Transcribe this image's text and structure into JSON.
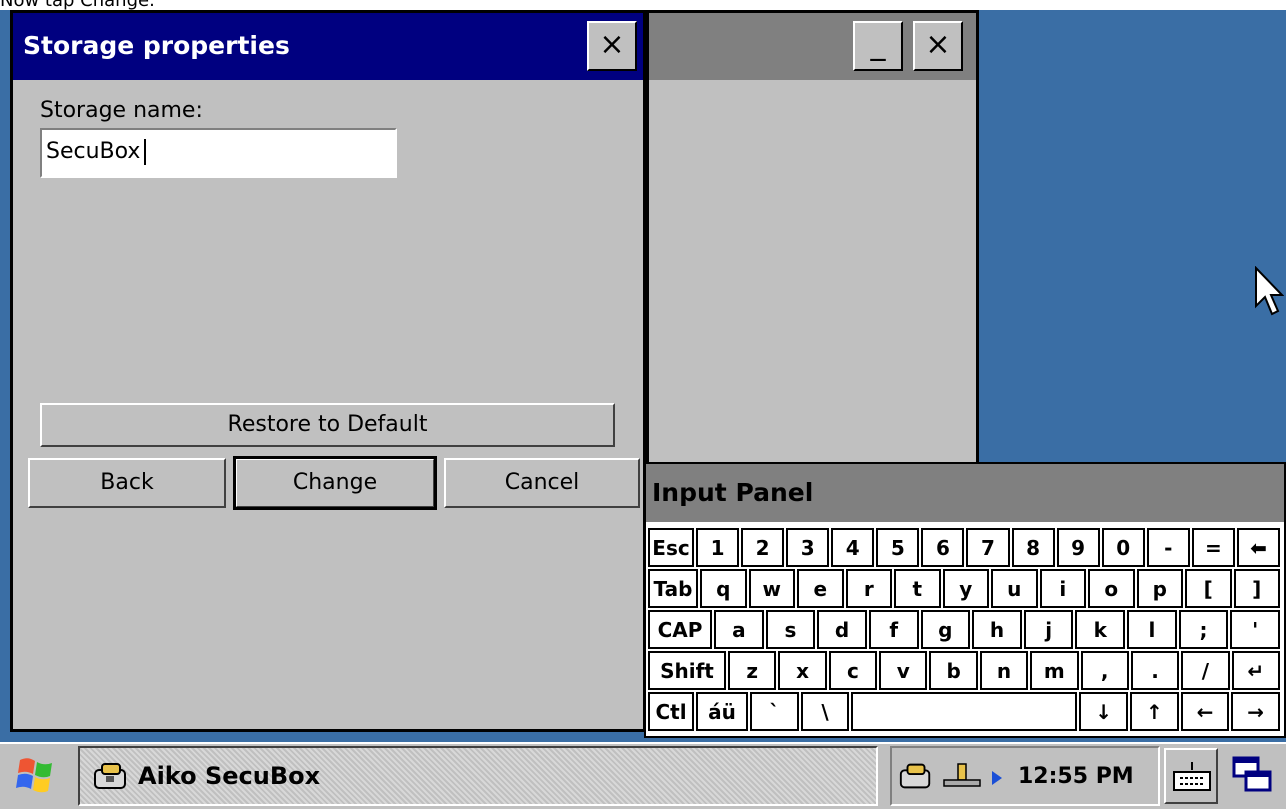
{
  "instruction": "Now tap Change.",
  "dialog": {
    "title": "Storage properties",
    "close_label": "×",
    "storage_name_label": "Storage name:",
    "storage_name_value": "SecuBox",
    "restore_label": "Restore to Default",
    "back_label": "Back",
    "change_label": "Change",
    "cancel_label": "Cancel"
  },
  "window2": {
    "minimize_label": "_",
    "close_label": "×"
  },
  "input_panel": {
    "title": "Input Panel",
    "rows": [
      [
        "Esc",
        "1",
        "2",
        "3",
        "4",
        "5",
        "6",
        "7",
        "8",
        "9",
        "0",
        "-",
        "=",
        "⬅"
      ],
      [
        "Tab",
        "q",
        "w",
        "e",
        "r",
        "t",
        "y",
        "u",
        "i",
        "o",
        "p",
        "[",
        "]"
      ],
      [
        "CAP",
        "a",
        "s",
        "d",
        "f",
        "g",
        "h",
        "j",
        "k",
        "l",
        ";",
        "'"
      ],
      [
        "Shift",
        "z",
        "x",
        "c",
        "v",
        "b",
        "n",
        "m",
        ",",
        ".",
        "/",
        "↵"
      ],
      [
        "Ctl",
        "áü",
        "`",
        "\\",
        " ",
        "↓",
        "↑",
        "←",
        "→"
      ]
    ]
  },
  "taskbar": {
    "task_label": "Aiko SecuBox",
    "time": "12:55 PM"
  },
  "colors": {
    "titlebar": "#000080",
    "desktop": "#3a6ea5",
    "face": "#c0c0c0"
  }
}
